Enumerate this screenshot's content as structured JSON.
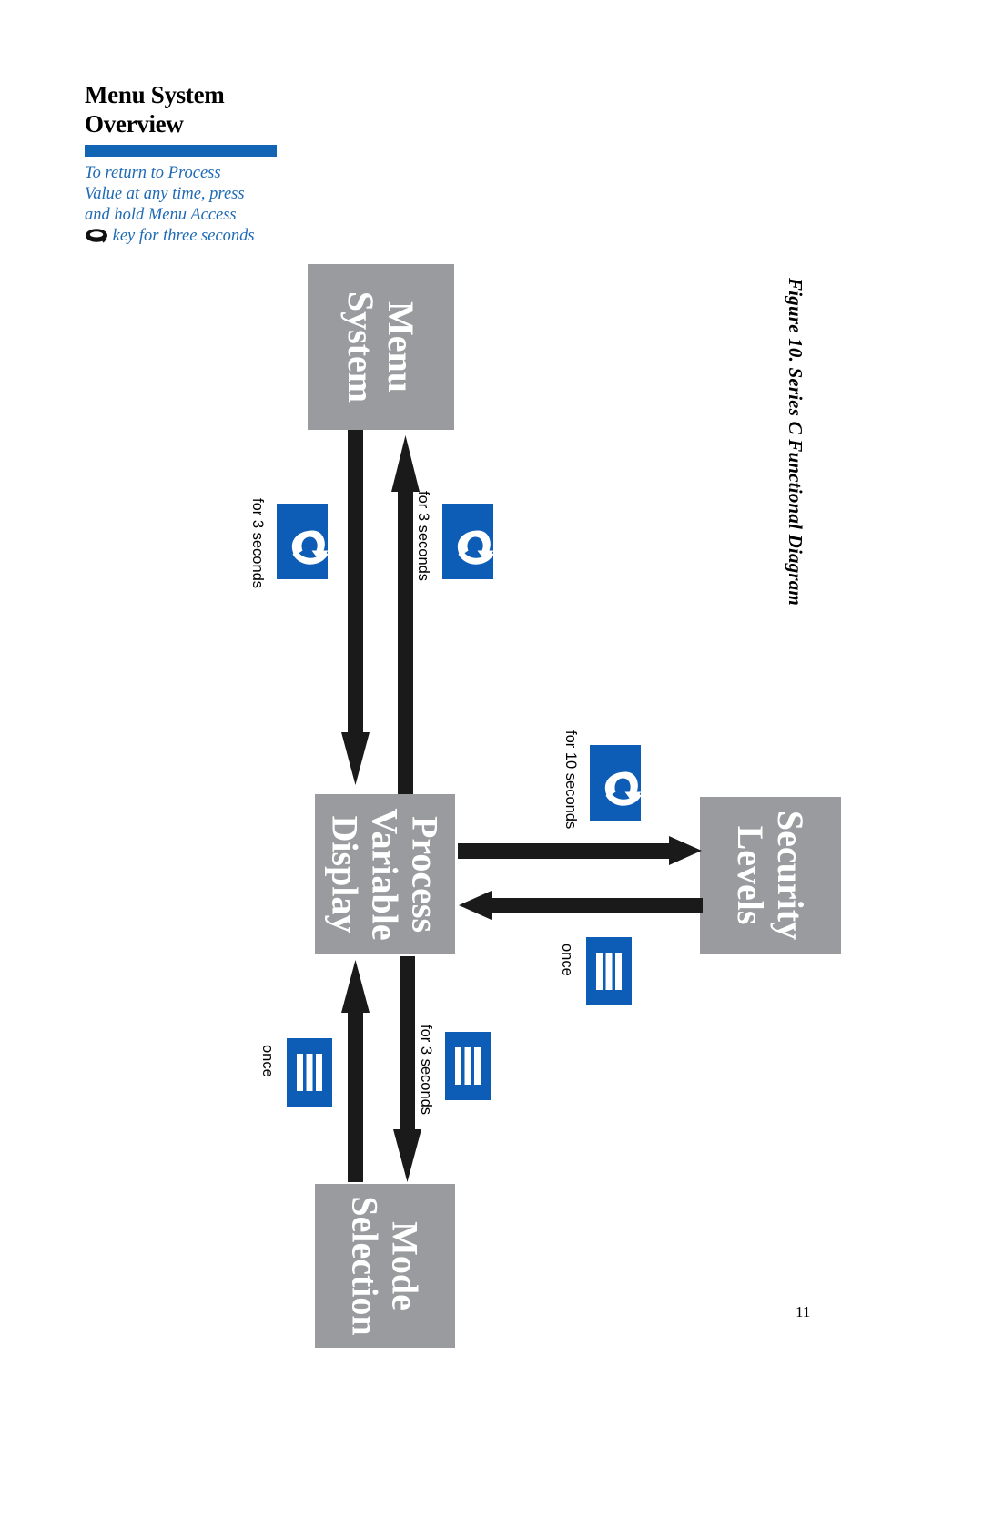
{
  "document": {
    "page_number": "11",
    "figure_caption": "Figure 10. Series C Functional Diagram"
  },
  "sidebar": {
    "title_line1": "Menu System",
    "title_line2": "Overview",
    "note_part1": "To return to Process Value at any time, press and hold Menu Access",
    "note_icon": "menu-access-key-icon",
    "note_part2": "key for three seconds"
  },
  "diagram": {
    "nodes": [
      {
        "id": "menu-system",
        "lines": [
          "Menu",
          "System"
        ]
      },
      {
        "id": "process-variable",
        "lines": [
          "Process",
          "Variable",
          "Display"
        ]
      },
      {
        "id": "security-levels",
        "lines": [
          "Security",
          "Levels"
        ]
      },
      {
        "id": "mode-selection",
        "lines": [
          "Mode",
          "Selection"
        ]
      }
    ],
    "transitions": [
      {
        "id": "menu-to-process",
        "from": "menu-system",
        "to": "process-variable",
        "label": "for 3 seconds",
        "icon": "menu-access-key-icon"
      },
      {
        "id": "process-to-menu",
        "from": "process-variable",
        "to": "menu-system",
        "label": "for 3 seconds",
        "icon": "menu-access-key-icon"
      },
      {
        "id": "process-to-security",
        "from": "process-variable",
        "to": "security-levels",
        "label": "for 10 seconds",
        "icon": "menu-access-key-icon"
      },
      {
        "id": "security-to-process",
        "from": "security-levels",
        "to": "process-variable",
        "label": "once",
        "icon": "mode-key-icon"
      },
      {
        "id": "process-to-mode",
        "from": "process-variable",
        "to": "mode-selection",
        "label": "for 3 seconds",
        "icon": "mode-key-icon"
      },
      {
        "id": "mode-to-process",
        "from": "mode-selection",
        "to": "process-variable",
        "label": "once",
        "icon": "mode-key-icon"
      }
    ]
  },
  "colors": {
    "accent_blue": "#1265b5",
    "note_blue": "#1f6ab5",
    "key_blue": "#0d5cb6",
    "node_gray": "#9a9b9e",
    "arrow_black": "#1a1a1a"
  }
}
